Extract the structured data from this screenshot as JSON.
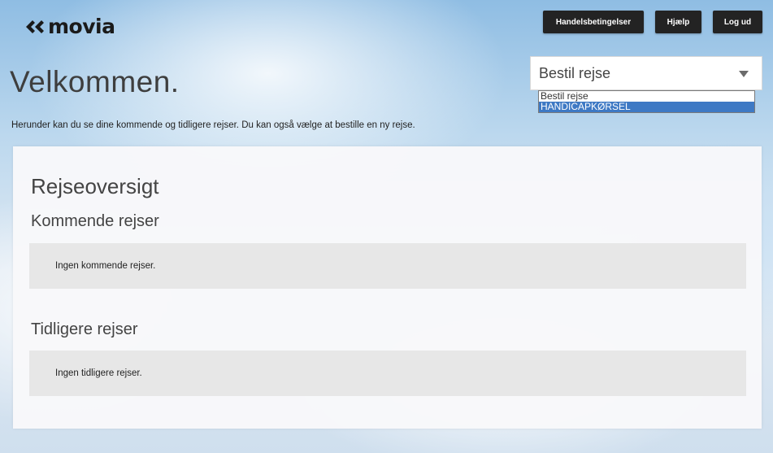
{
  "header": {
    "logo_text": "movia",
    "buttons": {
      "terms": "Handelsbetingelser",
      "help": "Hjælp",
      "logout": "Log ud"
    }
  },
  "welcome": {
    "title": "Velkommen.",
    "intro": "Herunder kan du se dine kommende og tidligere rejser. Du kan også vælge at bestille en ny rejse."
  },
  "booking_select": {
    "selected": "Bestil rejse",
    "options": [
      "Bestil rejse",
      "HANDICAPKØRSEL"
    ],
    "highlighted_index": 1
  },
  "overview": {
    "title": "Rejseoversigt",
    "upcoming_title": "Kommende rejser",
    "upcoming_empty": "Ingen kommende rejser.",
    "previous_title": "Tidligere rejser",
    "previous_empty": "Ingen tidligere rejser."
  },
  "colors": {
    "button_bg": "#232323",
    "highlight": "#3e79c4",
    "empty_box": "#e7e7e7"
  },
  "icons": {
    "logo": "movia-logo-icon",
    "dropdown": "triangle-down-icon"
  }
}
